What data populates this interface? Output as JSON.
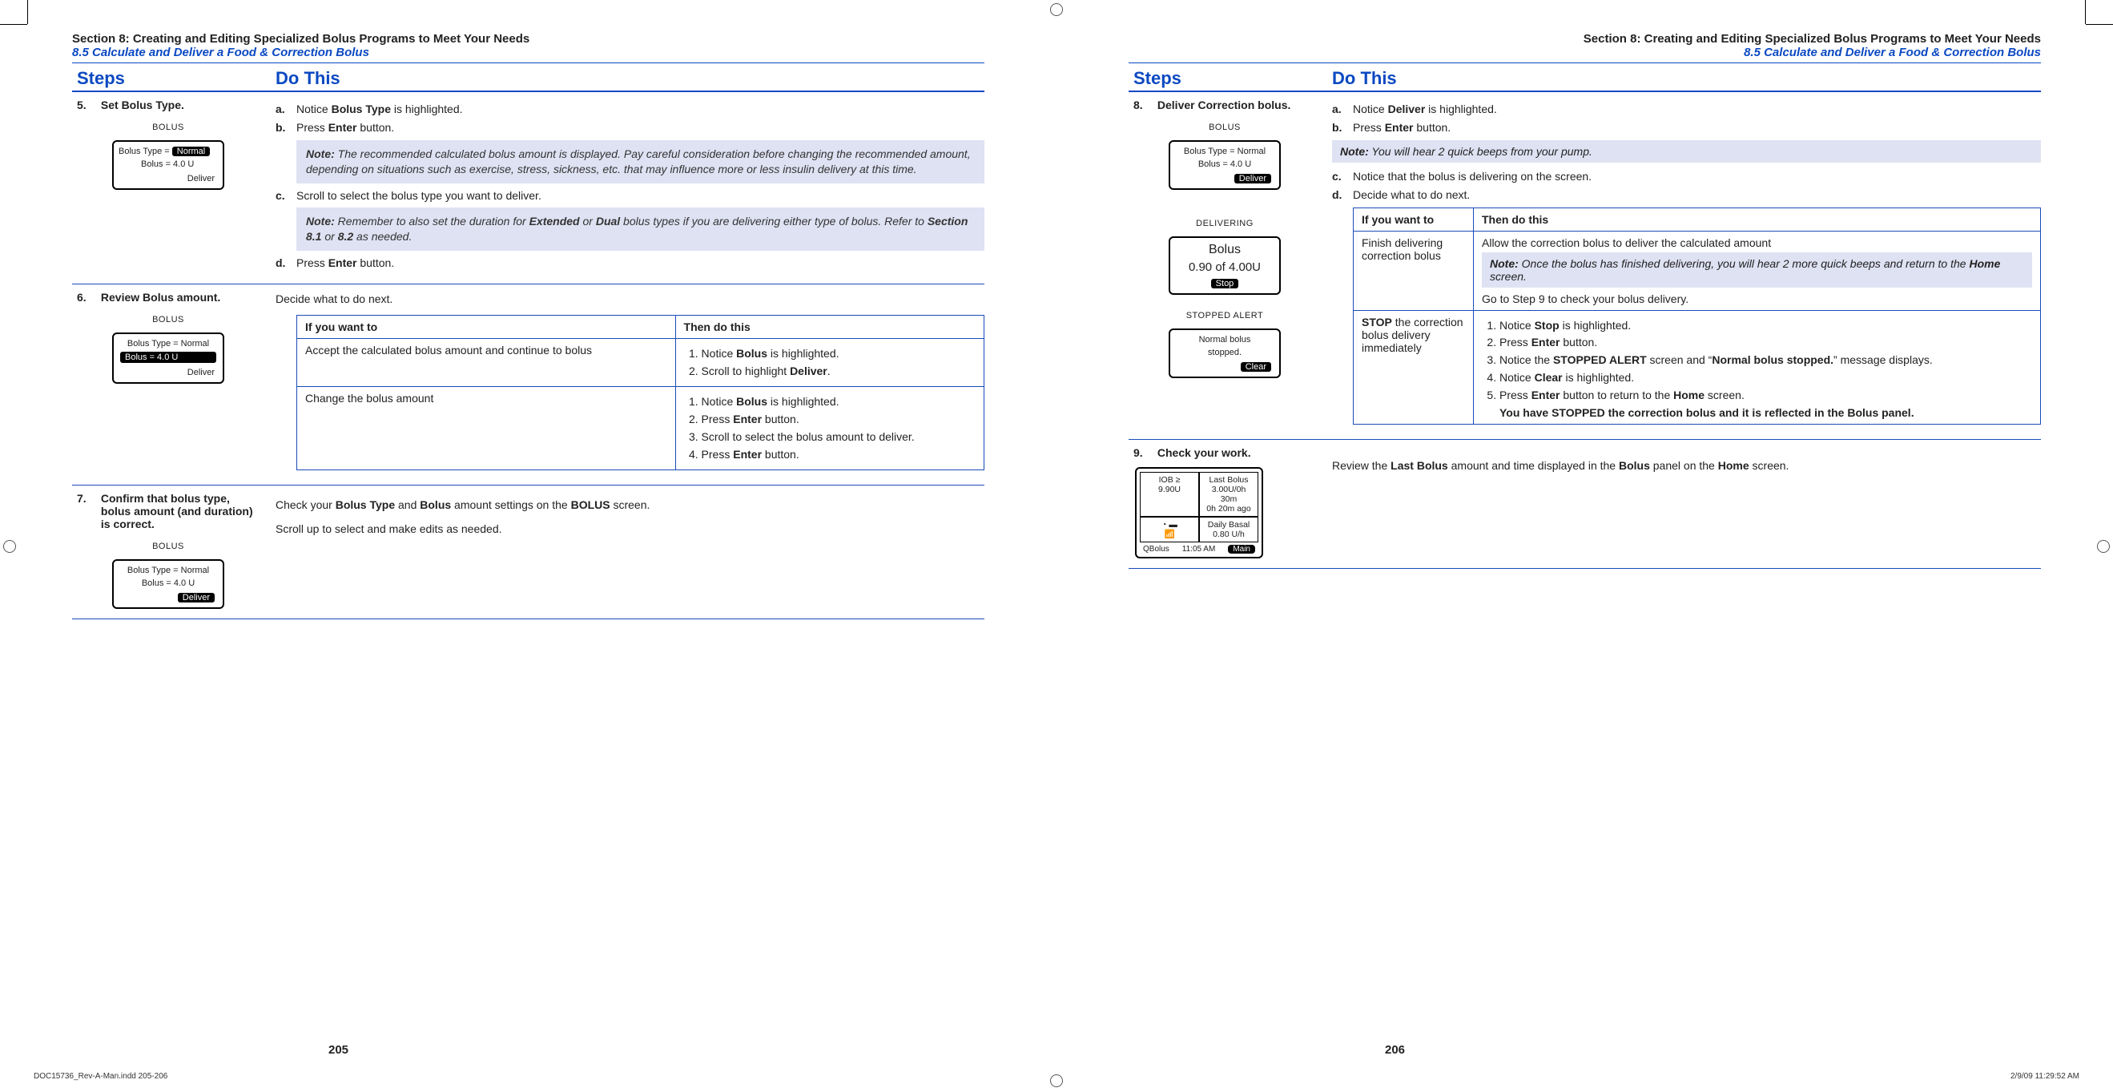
{
  "leftPage": {
    "sectionTitle": "Section 8: Creating and Editing Specialized Bolus Programs to Meet Your Needs",
    "subTitle": "8.5 Calculate and Deliver a Food & Correction Bolus",
    "cols": {
      "steps": "Steps",
      "dothis": "Do This"
    },
    "step5": {
      "num": "5.",
      "title": "Set Bolus Type.",
      "a": {
        "l": "a.",
        "t_pre": "Notice ",
        "t_b": "Bolus Type",
        "t_post": " is highlighted."
      },
      "b": {
        "l": "b.",
        "t_pre": "Press ",
        "t_b": "Enter",
        "t_post": " button."
      },
      "note1_label": "Note:",
      "note1": " The recommended calculated bolus amount is displayed. Pay careful consideration before changing the recommended amount, depending on situations such as exercise, stress, sickness, etc. that may influence more or less insulin delivery at this time.",
      "c": {
        "l": "c.",
        "t": "Scroll to select the bolus type you want to deliver."
      },
      "note2_label": "Note:",
      "note2_p1": " Remember to also set the duration for ",
      "note2_b1": "Extended",
      "note2_p2": " or ",
      "note2_b2": "Dual",
      "note2_p3": " bolus types if you are delivering either type of bolus. Refer to ",
      "note2_b3": "Section 8.1",
      "note2_p4": " or ",
      "note2_b4": "8.2",
      "note2_p5": " as needed.",
      "d": {
        "l": "d.",
        "t_pre": "Press ",
        "t_b": "Enter",
        "t_post": " button."
      },
      "screen": {
        "title": "BOLUS",
        "l1_pre": "Bolus Type = ",
        "l1_hl": "Normal",
        "l2": "Bolus = 4.0 U",
        "bot": "Deliver"
      }
    },
    "step6": {
      "num": "6.",
      "title": "Review Bolus amount.",
      "intro": "Decide what to do next.",
      "th1": "If you want to",
      "th2": "Then do this",
      "r1_c1": "Accept the calculated bolus amount and continue to bolus",
      "r1_1_pre": "Notice ",
      "r1_1_b": "Bolus",
      "r1_1_post": " is highlighted.",
      "r1_2_pre": "Scroll to highlight ",
      "r1_2_b": "Deliver",
      "r1_2_post": ".",
      "r2_c1": "Change the bolus amount",
      "r2_1_pre": "Notice ",
      "r2_1_b": "Bolus",
      "r2_1_post": " is highlighted.",
      "r2_2_pre": "Press ",
      "r2_2_b": "Enter",
      "r2_2_post": " button.",
      "r2_3": "Scroll to select the bolus amount to deliver.",
      "r2_4_pre": "Press ",
      "r2_4_b": "Enter",
      "r2_4_post": " button.",
      "screen": {
        "title": "BOLUS",
        "l1": "Bolus Type = Normal",
        "l2_hl": "Bolus = 4.0 U",
        "bot": "Deliver"
      }
    },
    "step7": {
      "num": "7.",
      "title": "Confirm that bolus type, bolus amount (and duration) is correct.",
      "p1_pre": "Check your ",
      "p1_b1": "Bolus Type",
      "p1_mid": " and ",
      "p1_b2": "Bolus",
      "p1_mid2": " amount settings on the ",
      "p1_b3": "BOLUS",
      "p1_post": " screen.",
      "p2": "Scroll up to select and make edits as needed.",
      "screen": {
        "title": "BOLUS",
        "l1": "Bolus Type = Normal",
        "l2": "Bolus = 4.0 U",
        "bot_hl": "Deliver"
      }
    },
    "pageNum": "205"
  },
  "rightPage": {
    "sectionTitle": "Section 8: Creating and Editing Specialized Bolus Programs to Meet Your Needs",
    "subTitle": "8.5 Calculate and Deliver a Food & Correction Bolus",
    "cols": {
      "steps": "Steps",
      "dothis": "Do This"
    },
    "step8": {
      "num": "8.",
      "title": "Deliver Correction bolus.",
      "a": {
        "l": "a.",
        "pre": "Notice ",
        "b": "Deliver",
        "post": " is highlighted."
      },
      "b": {
        "l": "b.",
        "pre": "Press ",
        "bld": "Enter",
        "post": " button."
      },
      "note_label": "Note:",
      "note": " You will hear 2 quick beeps from your pump.",
      "c": {
        "l": "c.",
        "t": "Notice that the bolus is delivering on the screen."
      },
      "d": {
        "l": "d.",
        "t": "Decide what to do next."
      },
      "th1": "If you want to",
      "th2": "Then do this",
      "r1_c1": "Finish delivering correction bolus",
      "r1_c2_1": "Allow the correction bolus to deliver the calculated amount",
      "r1_note_label": "Note:",
      "r1_note_p1": " Once the bolus has finished delivering, you will hear 2 more quick beeps and return to the ",
      "r1_note_b": "Home",
      "r1_note_p2": " screen.",
      "r1_c2_2": "Go to Step 9 to check your bolus delivery.",
      "r2_c1_b": "STOP",
      "r2_c1_rest": " the correction bolus delivery immediately",
      "r2_1_pre": "Notice ",
      "r2_1_b": "Stop",
      "r2_1_post": " is highlighted.",
      "r2_2_pre": "Press ",
      "r2_2_b": "Enter",
      "r2_2_post": " button.",
      "r2_3_pre": "Notice the ",
      "r2_3_b1": "STOPPED ALERT",
      "r2_3_mid": " screen and “",
      "r2_3_b2": "Normal bolus stopped.",
      "r2_3_post": "” message displays.",
      "r2_4_pre": "Notice ",
      "r2_4_b": "Clear",
      "r2_4_post": " is highlighted.",
      "r2_5_pre": "Press ",
      "r2_5_b1": "Enter",
      "r2_5_mid": " button to return to the ",
      "r2_5_b2": "Home",
      "r2_5_post": " screen.",
      "r2_final": "You have STOPPED the correction bolus and it is reflected in the Bolus panel.",
      "screen1": {
        "title": "BOLUS",
        "l1": "Bolus Type = Normal",
        "l2": "Bolus = 4.0 U",
        "bot_hl": "Deliver"
      },
      "screen2_above": "DELIVERING",
      "screen2": {
        "l1": "Bolus",
        "l2": "0.90 of 4.00U",
        "bot_hl": "Stop"
      },
      "screen3_above": "STOPPED ALERT",
      "screen3": {
        "l1": "Normal bolus",
        "l2": "stopped.",
        "bot_hl": "Clear"
      }
    },
    "step9": {
      "num": "9.",
      "title": "Check your work.",
      "p_pre": "Review the ",
      "p_b1": "Last Bolus",
      "p_mid1": " amount and time displayed in the ",
      "p_b2": "Bolus",
      "p_mid2": " panel on the ",
      "p_b3": "Home",
      "p_post": " screen.",
      "mini": {
        "iob_l": "IOB ≥",
        "iob_v": "9.90U",
        "lb_t": "Last Bolus",
        "lb_v1": "3.00U/0h 30m",
        "lb_v2": "0h 20m ago",
        "basal_t": "Daily Basal",
        "basal_v": "0.80 U/h",
        "bot_l": "QBolus",
        "bot_m": "11:05 AM",
        "bot_b": "Main"
      }
    },
    "pageNum": "206"
  },
  "footer": {
    "left": "DOC15736_Rev-A-Man.indd   205-206",
    "right": "2/9/09   11:29:52 AM"
  }
}
